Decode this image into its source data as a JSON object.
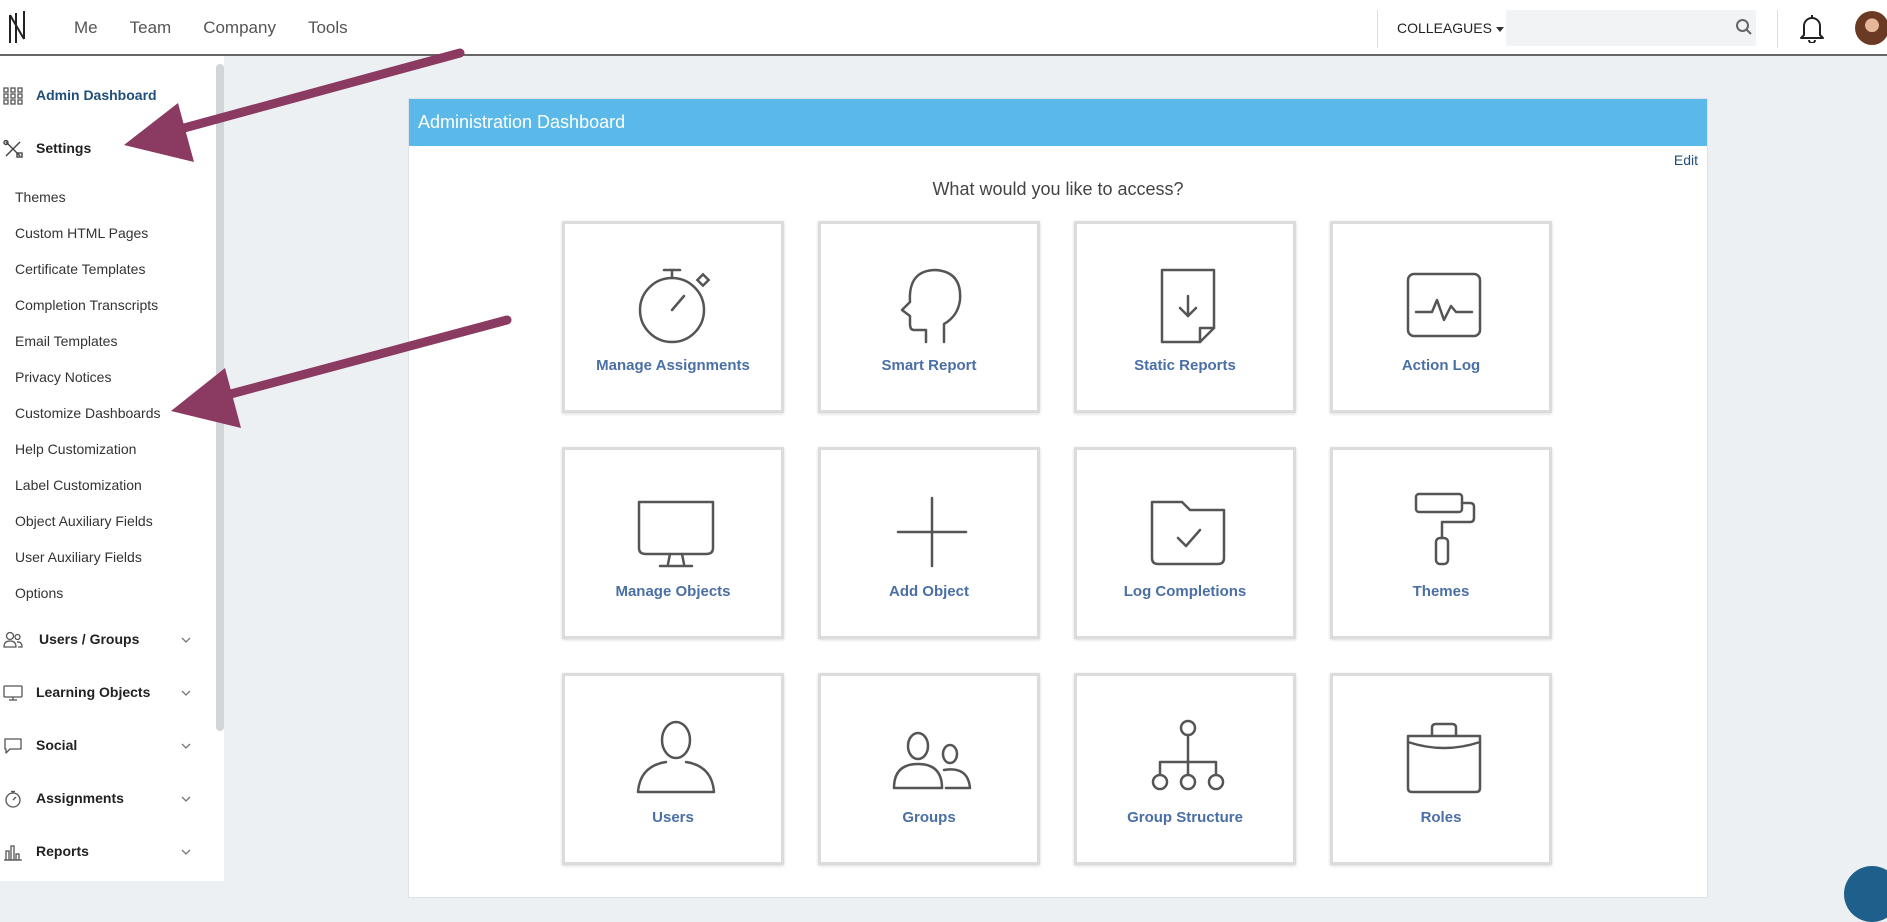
{
  "topbar": {
    "nav": [
      "Me",
      "Team",
      "Company",
      "Tools"
    ],
    "colleagues_label": "COLLEAGUES",
    "search": {
      "value": "",
      "placeholder": ""
    }
  },
  "sidebar": {
    "admin_dashboard": "Admin Dashboard",
    "settings": "Settings",
    "settings_items": [
      "Themes",
      "Custom HTML Pages",
      "Certificate Templates",
      "Completion Transcripts",
      "Email Templates",
      "Privacy Notices",
      "Customize Dashboards",
      "Help Customization",
      "Label Customization",
      "Object Auxiliary Fields",
      "User Auxiliary Fields",
      "Options"
    ],
    "sections": [
      "Users / Groups",
      "Learning Objects",
      "Social",
      "Assignments",
      "Reports"
    ]
  },
  "main": {
    "header": "Administration Dashboard",
    "edit": "Edit",
    "prompt": "What would you like to access?",
    "tiles": [
      {
        "label": "Manage Assignments",
        "icon": "stopwatch-icon"
      },
      {
        "label": "Smart Report",
        "icon": "head-profile-icon"
      },
      {
        "label": "Static Reports",
        "icon": "document-download-icon"
      },
      {
        "label": "Action Log",
        "icon": "activity-pulse-icon"
      },
      {
        "label": "Manage Objects",
        "icon": "monitor-icon"
      },
      {
        "label": "Add Object",
        "icon": "plus-icon"
      },
      {
        "label": "Log Completions",
        "icon": "folder-check-icon"
      },
      {
        "label": "Themes",
        "icon": "paint-roller-icon"
      },
      {
        "label": "Users",
        "icon": "user-icon"
      },
      {
        "label": "Groups",
        "icon": "users-group-icon"
      },
      {
        "label": "Group Structure",
        "icon": "hierarchy-icon"
      },
      {
        "label": "Roles",
        "icon": "briefcase-icon"
      }
    ]
  },
  "colors": {
    "header_blue": "#5ab9e8",
    "tile_label": "#4a6fa5",
    "annotation_arrow": "#8b3a62",
    "link_dark_blue": "#1f4e79"
  }
}
